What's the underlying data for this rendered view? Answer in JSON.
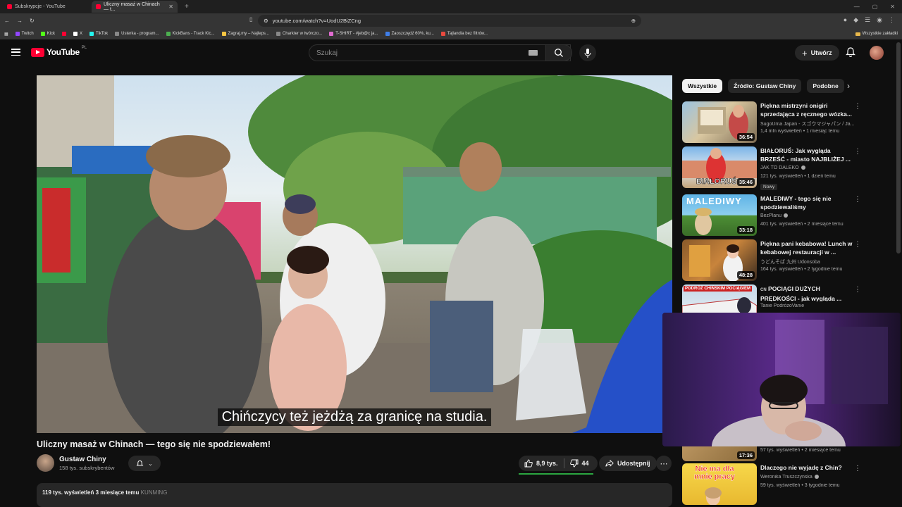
{
  "browser": {
    "tabs": [
      {
        "label": "Subskrypcje - YouTube",
        "active": false
      },
      {
        "label": "Uliczny masaż w Chinach — t...",
        "active": true
      }
    ],
    "url": "youtube.com/watch?v=UodU2BiZCng",
    "bookmarks": [
      "Twitch",
      "Kick",
      "X",
      "TikTok",
      "Usterka - program...",
      "KickBans - Track Kic...",
      "Zagraj.my – Najleps...",
      "Charkter w twórczo...",
      "T-SHIRT - #jeb@c ja...",
      "Zaoszczędź 60%, ku...",
      "Tajlandia bez filtrów..."
    ],
    "bookmarks_folder": "Wszystkie zakładki"
  },
  "header": {
    "logo_text": "YouTube",
    "country": "PL",
    "search_placeholder": "Szukaj",
    "create_label": "Utwórz"
  },
  "video": {
    "subtitle": "Chińczycy też jeżdżą za granicę na studia.",
    "title": "Uliczny masaż w Chinach — tego się nie spodziewałem!",
    "channel_name": "Gustaw Chiny",
    "channel_subs": "158 tys. subskrybentów",
    "likes": "8,9 tys.",
    "like_ratio": 0.95,
    "dislikes": "44",
    "share_label": "Udostępnij",
    "desc_stats": "119 tys. wyświetleń  3 miesiące temu",
    "desc_tag": "KUNMING"
  },
  "sidebar": {
    "chips": [
      "Wszystkie",
      "Źródło: Gustaw Chiny",
      "Podobne"
    ],
    "recommendations": [
      {
        "title": "Piękna mistrzyni onigiri sprzedająca z ręcznego wózka...",
        "channel": "SugoUma Japan - スゴウマジャパン / Ja...",
        "meta": "1,4 mln wyświetleń • 1 miesiąc temu",
        "duration": "36:54",
        "verified": false,
        "badge": ""
      },
      {
        "title": "BIAŁORUŚ: Jak wygląda BRZEŚĆ - miasto NAJBLIŻEJ ...",
        "channel": "JAK TO DALEKO",
        "meta": "121 tys. wyświetleń • 1 dzień temu",
        "duration": "35:46",
        "verified": true,
        "badge": "Nowy"
      },
      {
        "title": "MALEDIWY - tego się nie spodziewaliśmy",
        "channel": "BezPlanu",
        "meta": "401 tys. wyświetleń • 2 miesiące temu",
        "duration": "33:18",
        "verified": true,
        "badge": ""
      },
      {
        "title": "Piękna pani kebabowa! Lunch w kebabowej restauracji w ...",
        "channel": "うどんそば 九州 Udonsoba",
        "meta": "164 tys. wyświetleń • 2 tygodnie temu",
        "duration": "48:28",
        "verified": false,
        "badge": ""
      },
      {
        "title": "POCIĄGI DUŻYCH PRĘDKOŚCI - jak wygląda ...",
        "channel": "Tanie PodróżoVanie",
        "meta": "",
        "duration": "",
        "verified": false,
        "badge": "",
        "prefix": "CN"
      },
      {
        "title": "",
        "channel": "",
        "meta": "57 tys. wyświetleń • 2 miesiące temu",
        "duration": "17:36",
        "verified": false,
        "badge": ""
      },
      {
        "title": "Dlaczego nie wyjadę z Chin?",
        "channel": "Weronika Truszczynska",
        "meta": "59 tys. wyświetleń • 3 tygodnie temu",
        "duration": "",
        "verified": true,
        "badge": ""
      }
    ],
    "thumb_texts": [
      "BIAŁORUŚ",
      "MALEDIWY",
      "PODRÓŻ CHIŃSKIM POCIĄGIEM",
      "Nie ma dla mnie pracy"
    ]
  },
  "colors": {
    "bg": "#0f0f0f",
    "accent": "#ff0033",
    "like_bar": "#2ba640"
  }
}
